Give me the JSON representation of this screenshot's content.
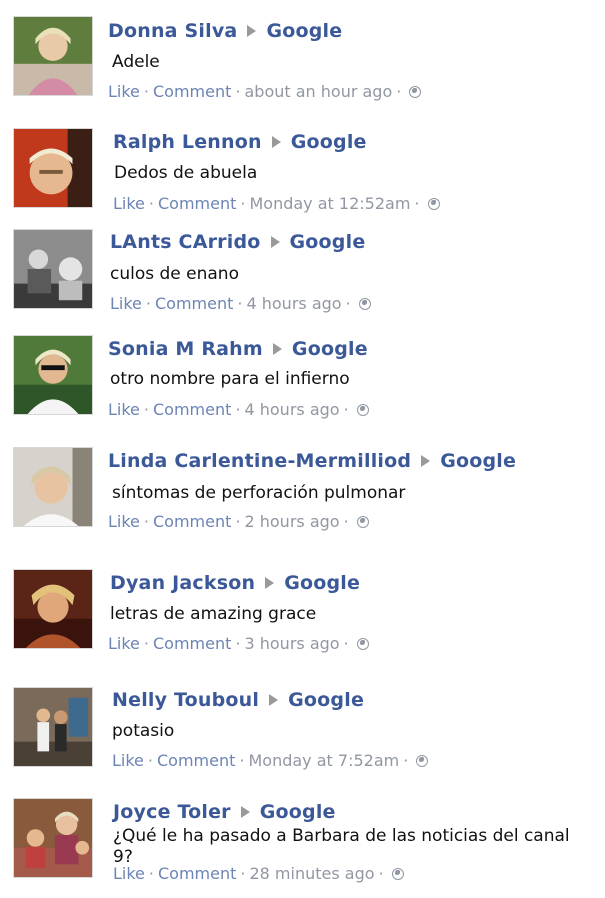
{
  "separator": "·",
  "posts": [
    {
      "author": "Donna Silva",
      "target": "Google",
      "message": "Adele",
      "like": "Like",
      "comment": "Comment",
      "time": "about an hour ago"
    },
    {
      "author": "Ralph Lennon",
      "target": "Google",
      "message": "Dedos de abuela",
      "like": "Like",
      "comment": "Comment",
      "time": "Monday at 12:52am"
    },
    {
      "author": "LAnts CArrido",
      "target": "Google",
      "message": "culos de enano",
      "like": "Like",
      "comment": "Comment",
      "time": "4 hours ago"
    },
    {
      "author": "Sonia M Rahm",
      "target": "Google",
      "message": "otro nombre para el infierno",
      "like": "Like",
      "comment": "Comment",
      "time": "4 hours ago"
    },
    {
      "author": "Linda Carlentine-Mermilliod",
      "target": "Google",
      "message": "síntomas de perforación pulmonar",
      "like": "Like",
      "comment": "Comment",
      "time": "2 hours ago"
    },
    {
      "author": "Dyan Jackson",
      "target": "Google",
      "message": "letras de amazing grace",
      "like": "Like",
      "comment": "Comment",
      "time": "3 hours ago"
    },
    {
      "author": "Nelly Touboul",
      "target": "Google",
      "message": "potasio",
      "like": "Like",
      "comment": "Comment",
      "time": "Monday at 7:52am"
    },
    {
      "author": "Joyce Toler",
      "target": "Google",
      "message": "¿Qué le ha pasado a Barbara de las noticias del canal 9?",
      "like": "Like",
      "comment": "Comment",
      "time": "28 minutes ago"
    }
  ]
}
